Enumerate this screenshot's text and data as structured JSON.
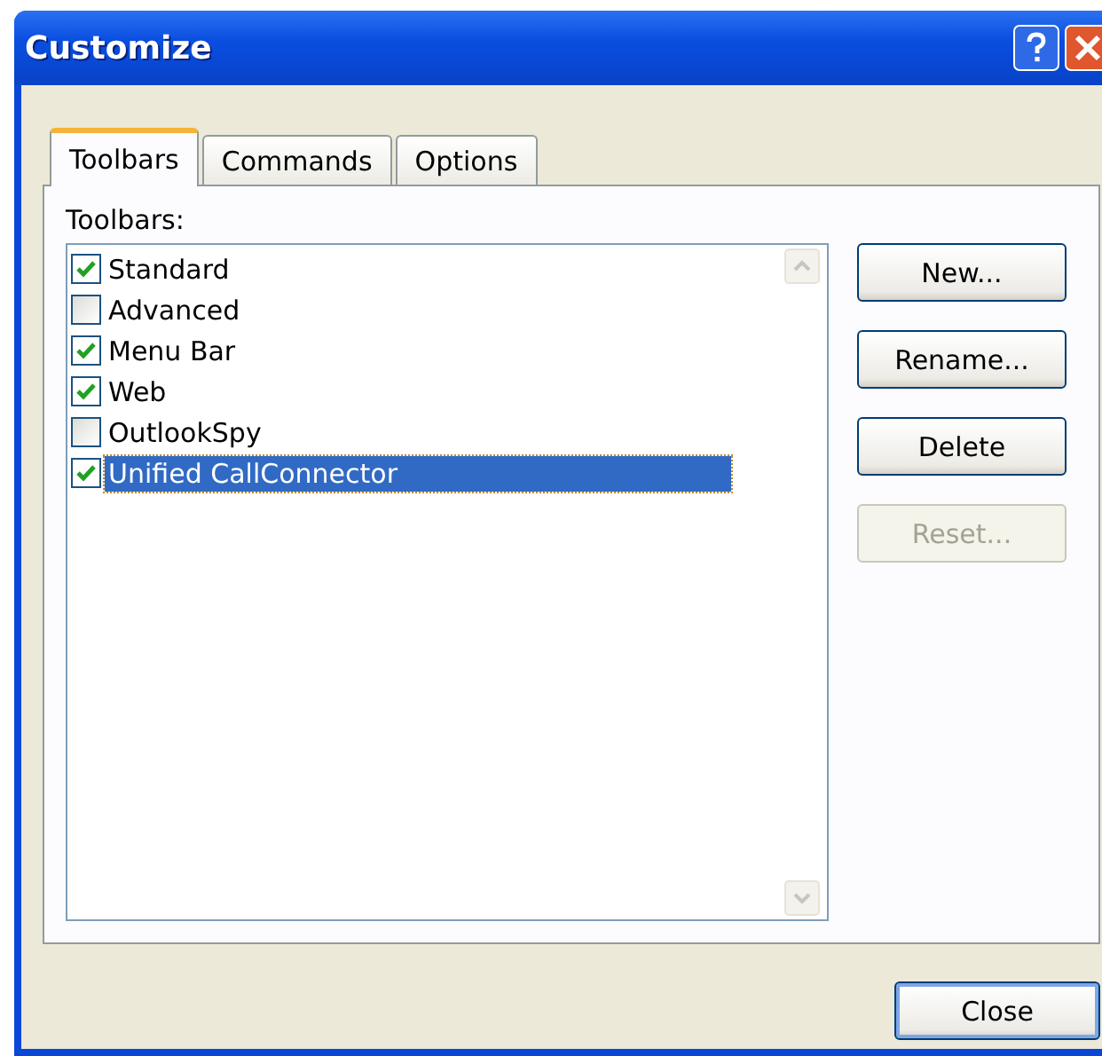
{
  "window": {
    "title": "Customize"
  },
  "tabs": [
    {
      "label": "Toolbars",
      "selected": true
    },
    {
      "label": "Commands",
      "selected": false
    },
    {
      "label": "Options",
      "selected": false
    }
  ],
  "toolbars_label": "Toolbars:",
  "toolbars": [
    {
      "name": "Standard",
      "checked": true,
      "selected": false
    },
    {
      "name": "Advanced",
      "checked": false,
      "selected": false
    },
    {
      "name": "Menu Bar",
      "checked": true,
      "selected": false
    },
    {
      "name": "Web",
      "checked": true,
      "selected": false
    },
    {
      "name": "OutlookSpy",
      "checked": false,
      "selected": false
    },
    {
      "name": "Unified CallConnector",
      "checked": true,
      "selected": true
    }
  ],
  "side_buttons": [
    {
      "label": "New...",
      "disabled": false
    },
    {
      "label": "Rename...",
      "disabled": false
    },
    {
      "label": "Delete",
      "disabled": false
    },
    {
      "label": "Reset...",
      "disabled": true
    }
  ],
  "close_button": "Close"
}
